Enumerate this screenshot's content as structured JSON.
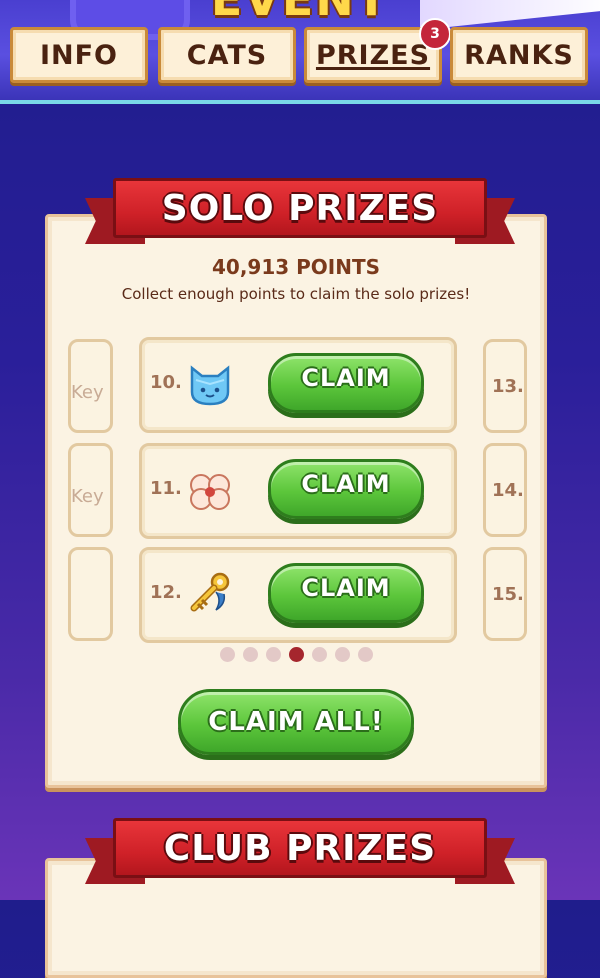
{
  "header": {
    "event_title": "EVENT",
    "tabs": [
      {
        "label": "INFO"
      },
      {
        "label": "CATS"
      },
      {
        "label": "PRIZES",
        "badge": "3"
      },
      {
        "label": "RANKS"
      }
    ]
  },
  "solo": {
    "title": "SOLO PRIZES",
    "points": "40,913 POINTS",
    "subtitle": "Collect enough points to claim the solo prizes!",
    "left_hints": [
      "Key",
      "Key"
    ],
    "rows": [
      {
        "number": "10.",
        "icon": "blue-cat-gem-icon",
        "button": "CLAIM"
      },
      {
        "number": "11.",
        "icon": "cotton-flower-icon",
        "button": "CLAIM"
      },
      {
        "number": "12.",
        "icon": "golden-key-icon",
        "button": "CLAIM"
      }
    ],
    "right_numbers": [
      "13.",
      "14.",
      "15."
    ],
    "page_count": 7,
    "active_page": 4,
    "claim_all": "CLAIM ALL!"
  },
  "club": {
    "title": "CLUB PRIZES"
  },
  "colors": {
    "background": "#2a1f9a",
    "ribbon_red": "#cf2128",
    "claim_green": "#5cc63b",
    "panel_cream": "#fbf3e3",
    "active_dot": "#a5262d"
  }
}
